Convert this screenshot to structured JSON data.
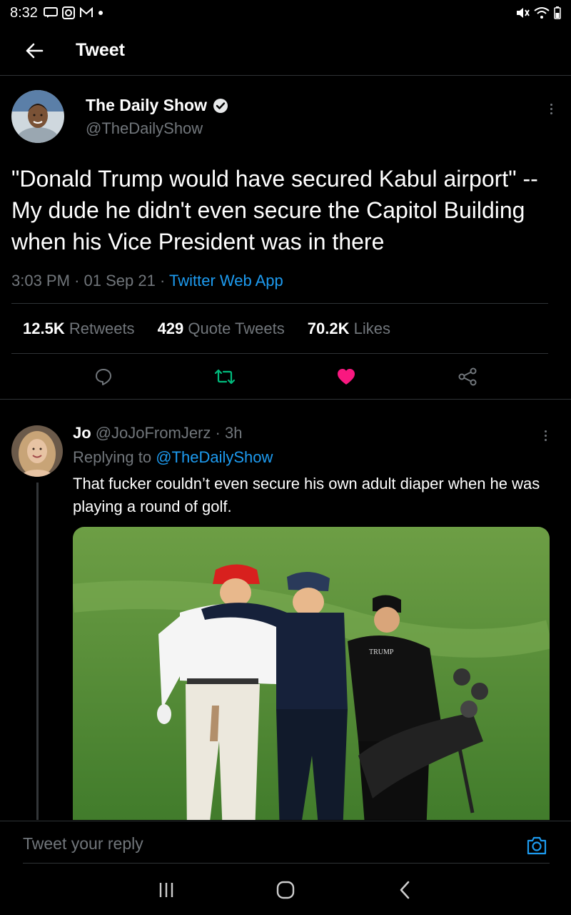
{
  "status_bar": {
    "time": "8:32"
  },
  "header": {
    "title": "Tweet"
  },
  "tweet": {
    "display_name": "The Daily Show",
    "handle": "@TheDailyShow",
    "text": "\"Donald Trump would have secured Kabul airport\" -- My dude he didn't even secure the Capitol Building when his Vice President was in there",
    "time": "3:03 PM",
    "date": "01 Sep 21",
    "source": "Twitter Web App",
    "stats": {
      "retweets_value": "12.5K",
      "retweets_label": "Retweets",
      "quotes_value": "429",
      "quotes_label": "Quote Tweets",
      "likes_value": "70.2K",
      "likes_label": "Likes"
    },
    "like_color": "#f91880",
    "retweet_color": "#00ba7c"
  },
  "reply": {
    "display_name": "Jo",
    "handle": "@JoJoFromJerz",
    "age": "3h",
    "replying_prefix": "Replying to",
    "replying_to": "@TheDailyShow",
    "text": "That fucker couldn’t even secure his own adult diaper when he was playing a round of golf.",
    "image_caption": "TRUMP"
  },
  "reply_bar": {
    "placeholder": "Tweet your reply"
  },
  "colors": {
    "accent": "#1d9bf0",
    "background": "#000000",
    "muted": "#71767b"
  }
}
